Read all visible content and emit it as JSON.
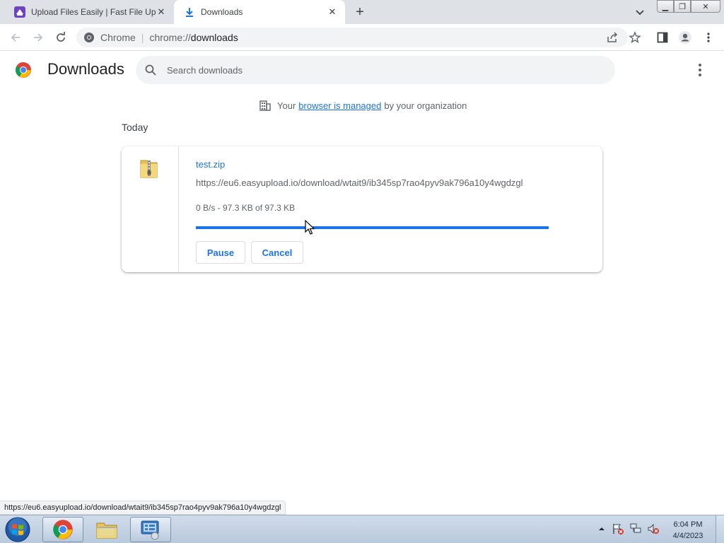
{
  "browser": {
    "tabs": [
      {
        "label": "Upload Files Easily | Fast File Uplo",
        "icon": "easyupload-favicon",
        "active": false
      },
      {
        "label": "Downloads",
        "icon": "download-icon",
        "active": true
      }
    ],
    "omnibox": {
      "chip": "Chrome",
      "url_scheme": "chrome://",
      "url_path": "downloads"
    }
  },
  "downloads_page": {
    "title": "Downloads",
    "search_placeholder": "Search downloads",
    "managed_prefix": "Your",
    "managed_link": "browser is managed",
    "managed_suffix": "by your organization",
    "section": "Today",
    "item": {
      "filename": "test.zip",
      "url": "https://eu6.easyupload.io/download/wtait9/ib345sp7rao4pyv9ak796a10y4wgdzgl",
      "status": "0 B/s - 97.3 KB of 97.3 KB",
      "progress_fraction": 1.0,
      "pause_label": "Pause",
      "cancel_label": "Cancel"
    }
  },
  "status_bar": {
    "text": "https://eu6.easyupload.io/download/wtait9/ib345sp7rao4pyv9ak796a10y4wgdzgl"
  },
  "taskbar": {
    "time": "6:04 PM",
    "date": "4/4/2023"
  },
  "colors": {
    "accent": "#1a73e8",
    "tab_strip": "#dee1e6",
    "taskbar": "#c5d4e6"
  }
}
